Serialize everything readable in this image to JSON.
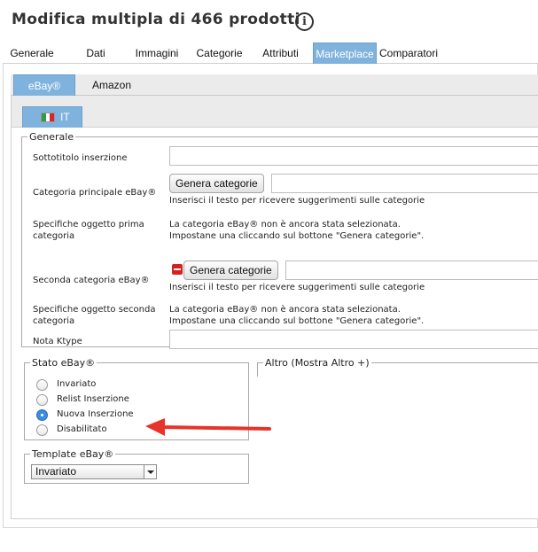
{
  "page": {
    "title": "Modifica multipla di 466 prodotti",
    "info_icon": "info-icon"
  },
  "main_tabs": [
    "Generale",
    "Dati",
    "Immagini",
    "Categorie",
    "Attributi",
    "Marketplace",
    "Comparatori"
  ],
  "main_tabs_active": "Marketplace",
  "sub_tabs": [
    "eBay®",
    "Amazon"
  ],
  "sub_tabs_active": "eBay®",
  "lang_tab": {
    "label": "IT",
    "flag": "italy-flag-icon"
  },
  "generale": {
    "legend": "Generale",
    "sottotitolo_label": "Sottotitolo inserzione",
    "categoria_principale_label": "Categoria principale eBay®",
    "genera_button": "Genera categorie",
    "hint_testo": "Inserisci il testo per ricevere suggerimenti sulle categorie",
    "specifiche_prima_label": "Specifiche oggetto prima categoria",
    "specifiche_prima_text_1": "La categoria eBay® non è ancora stata selezionata.",
    "specifiche_prima_text_2": "Impostane una cliccando sul bottone \"Genera categorie\".",
    "seconda_categoria_label": "Seconda categoria eBay®",
    "genera_button_2": "Genera categorie",
    "hint_testo_2": "Inserisci il testo per ricevere suggerimenti sulle categorie",
    "specifiche_seconda_label": "Specifiche oggetto seconda categoria",
    "specifiche_seconda_text_1": "La categoria eBay® non è ancora stata selezionata.",
    "specifiche_seconda_text_2": "Impostane una cliccando sul bottone \"Genera categorie\".",
    "nota_ktype_label": "Nota Ktype"
  },
  "stato": {
    "legend": "Stato eBay®",
    "options": [
      "Invariato",
      "Relist Inserzione",
      "Nuova Inserzione",
      "Disabilitato"
    ],
    "selected": "Nuova Inserzione"
  },
  "altro": {
    "legend": "Altro (Mostra Altro +)"
  },
  "template": {
    "legend": "Template eBay®",
    "selected": "Invariato"
  },
  "colors": {
    "active_tab": "#7fb3de",
    "arrow": "#e8332a",
    "checked_radio": "#3b8de0"
  }
}
